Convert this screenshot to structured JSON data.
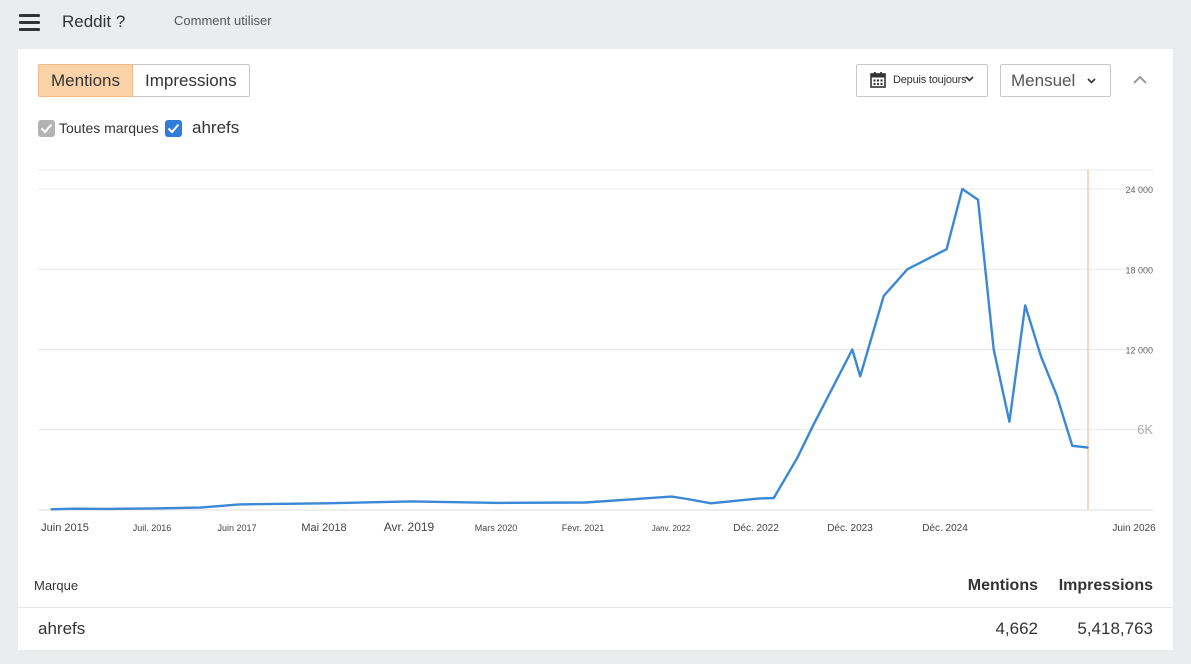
{
  "header": {
    "title": "Reddit ?",
    "help_link": "Comment utiliser"
  },
  "toggles": {
    "mentions": "Mentions",
    "impressions": "Impressions",
    "active": "Mentions"
  },
  "filters": {
    "date_range": "Depuis toujours",
    "granularity": "Mensuel"
  },
  "checkboxes": [
    {
      "label": "Toutes marques",
      "checked": true,
      "color": "#b3b3b3"
    },
    {
      "label": "ahrefs",
      "checked": true,
      "color": "#2f7dd8"
    }
  ],
  "colors": {
    "accent": "#fcd3a8",
    "line": "#3a88d6",
    "marker": "#f6cba6",
    "grid": "#e9e9e9"
  },
  "chart_data": {
    "type": "line",
    "series": [
      {
        "name": "ahrefs",
        "x": [
          "2015-06",
          "2015-09",
          "2016-01",
          "2016-07",
          "2017-01",
          "2017-06",
          "2018-05",
          "2019-04",
          "2020-03",
          "2021-02",
          "2022-01",
          "2022-03",
          "2022-06",
          "2022-12",
          "2023-02",
          "2023-05",
          "2023-07",
          "2023-12",
          "2024-01",
          "2024-04",
          "2024-07",
          "2024-12",
          "2025-02",
          "2025-04",
          "2025-06",
          "2025-08",
          "2025-10",
          "2025-12",
          "2026-02",
          "2026-04",
          "2026-06"
        ],
        "values": [
          50,
          100,
          80,
          120,
          180,
          420,
          500,
          640,
          530,
          560,
          1000,
          820,
          500,
          850,
          900,
          3900,
          6300,
          12000,
          10000,
          16000,
          18000,
          19500,
          24000,
          23200,
          12000,
          6600,
          15300,
          11500,
          8600,
          4800,
          4662
        ]
      }
    ],
    "xticks": [
      "Juin 2015",
      "Juil. 2016",
      "Juin 2017",
      "Mai 2018",
      "Avr. 2019",
      "Mars 2020",
      "Févr. 2021",
      "Janv. 2022",
      "Déc. 2022",
      "Déc. 2023",
      "Déc. 2024",
      "Juin 2026"
    ],
    "yticks": [
      "24 000",
      "18 000",
      "12 000",
      "6K"
    ],
    "ylim": [
      0,
      24000
    ],
    "grid": true,
    "title": "",
    "xlabel": "",
    "ylabel": ""
  },
  "table": {
    "headers": {
      "brand": "Marque",
      "mentions": "Mentions",
      "impressions": "Impressions"
    },
    "rows": [
      {
        "brand": "ahrefs",
        "mentions": "4,662",
        "impressions": "5,418,763"
      }
    ]
  }
}
